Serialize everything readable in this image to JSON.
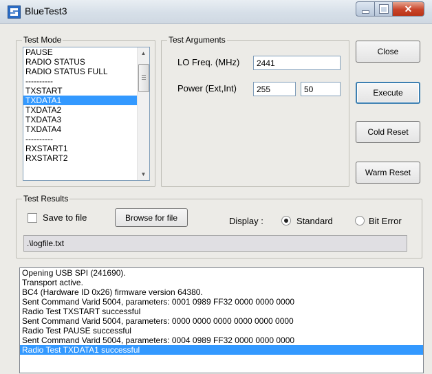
{
  "window": {
    "title": "BlueTest3",
    "icons": {
      "app": "bluetooth-app-icon",
      "minimize": "minimize-icon",
      "maximize": "maximize-icon",
      "close": "close-window-icon"
    }
  },
  "test_mode": {
    "label": "Test Mode",
    "items": [
      {
        "label": "PAUSE",
        "selected": false
      },
      {
        "label": "RADIO STATUS",
        "selected": false
      },
      {
        "label": "RADIO STATUS FULL",
        "selected": false
      },
      {
        "label": "----------",
        "selected": false
      },
      {
        "label": "TXSTART",
        "selected": false
      },
      {
        "label": "TXDATA1",
        "selected": true
      },
      {
        "label": "TXDATA2",
        "selected": false
      },
      {
        "label": "TXDATA3",
        "selected": false
      },
      {
        "label": "TXDATA4",
        "selected": false
      },
      {
        "label": "----------",
        "selected": false
      },
      {
        "label": "RXSTART1",
        "selected": false
      },
      {
        "label": "RXSTART2",
        "selected": false
      }
    ]
  },
  "test_arguments": {
    "label": "Test Arguments",
    "lo_freq_label": "LO Freq. (MHz)",
    "lo_freq_value": "2441",
    "power_label": "Power (Ext,Int)",
    "power_ext_value": "255",
    "power_int_value": "50"
  },
  "buttons": {
    "close": "Close",
    "execute": "Execute",
    "cold_reset": "Cold Reset",
    "warm_reset": "Warm Reset",
    "browse": "Browse for file"
  },
  "test_results": {
    "label": "Test Results",
    "save_to_file_label": "Save to file",
    "save_to_file_checked": false,
    "display_label": "Display :",
    "display_options": [
      {
        "label": "Standard",
        "selected": true
      },
      {
        "label": "Bit Error",
        "selected": false
      }
    ],
    "file_path": ".\\logfile.txt"
  },
  "log": {
    "lines": [
      {
        "text": "Opening USB SPI (241690).",
        "selected": false
      },
      {
        "text": "Transport active.",
        "selected": false
      },
      {
        "text": "BC4 (Hardware ID 0x26) firmware version 64380.",
        "selected": false
      },
      {
        "text": "Sent Command Varid 5004, parameters: 0001 0989 FF32 0000 0000 0000",
        "selected": false
      },
      {
        "text": "Radio Test TXSTART successful",
        "selected": false
      },
      {
        "text": "Sent Command Varid 5004, parameters: 0000 0000 0000 0000 0000 0000",
        "selected": false
      },
      {
        "text": "Radio Test PAUSE successful",
        "selected": false
      },
      {
        "text": "Sent Command Varid 5004, parameters: 0004 0989 FF32 0000 0000 0000",
        "selected": false
      },
      {
        "text": "Radio Test TXDATA1 successful",
        "selected": true
      }
    ]
  }
}
